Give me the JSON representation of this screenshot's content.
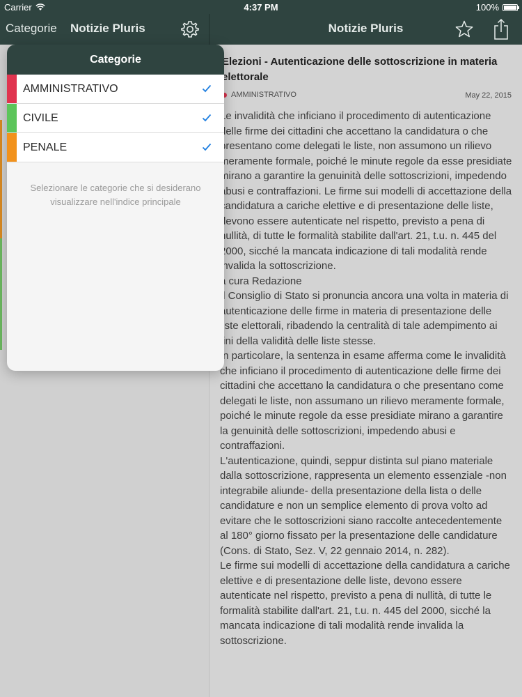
{
  "status_bar": {
    "carrier": "Carrier",
    "time": "4:37 PM",
    "battery": "100%"
  },
  "nav_left": {
    "categorie": "Categorie",
    "title": "Notizie Pluris"
  },
  "nav_right": {
    "title": "Notizie Pluris"
  },
  "popover": {
    "title": "Categorie",
    "categories": [
      {
        "label": "AMMINISTRATIVO",
        "color": "#e0344f",
        "checked": true
      },
      {
        "label": "CIVILE",
        "color": "#5cc55a",
        "checked": true
      },
      {
        "label": "PENALE",
        "color": "#f2921c",
        "checked": true
      }
    ],
    "note": "Selezionare le categorie che si desiderano visualizzare nell'indice principale"
  },
  "article": {
    "title": "Elezioni   - Autenticazione delle sottoscrizione in materia elettorale",
    "category": "AMMINISTRATIVO",
    "date": "May 22, 2015",
    "paragraphs": [
      "Le invalidità che inficiano il procedimento di autenticazione delle firme dei cittadini che accettano la candidatura o che presentano come delegati le liste, non assumono un rilievo meramente formale, poiché le minute regole da esse presidiate mirano a garantire la genuinità delle sottoscrizioni, impedendo abusi e contraffazioni. Le firme sui modelli di accettazione della candidatura a cariche elettive e di presentazione delle liste, devono essere autenticate nel rispetto, previsto a pena di nullità, di tutte le formalità stabilite dall'art. 21, t.u. n. 445 del 2000, sicché la mancata indicazione di tali modalità rende invalida la sottoscrizione.",
      "a cura Redazione",
      "Il Consiglio di Stato si pronuncia ancora una volta in materia di autenticazione delle firme in materia di presentazione delle liste elettorali, ribadendo la centralità di tale adempimento ai fini della validità delle liste stesse.",
      "In particolare, la sentenza in esame afferma come le invalidità che inficiano il procedimento di autenticazione delle firme dei cittadini che accettano la candidatura o che presentano come delegati le liste, non assumano un rilievo meramente formale, poiché le minute regole da esse presidiate mirano a garantire la genuinità delle sottoscrizioni, impedendo abusi e contraffazioni.",
      "L'autenticazione, quindi, seppur distinta sul piano materiale dalla sottoscrizione, rappresenta un elemento essenziale -non integrabile aliunde- della presentazione della lista o delle candidature e non un semplice elemento di prova volto ad evitare che le sottoscrizioni siano raccolte antecedentemente al 180° giorno fissato per la presentazione delle candidature (Cons. di Stato, Sez. V, 22 gennaio 2014, n. 282).",
      "Le firme sui modelli di accettazione della candidatura a cariche elettive e di presentazione delle liste, devono essere autenticate nel rispetto, previsto a pena di nullità, di tutte le formalità stabilite dall'art. 21, t.u. n. 445 del 2000, sicché la mancata indicazione di tali modalità rende invalida la sottoscrizione."
    ]
  },
  "colors": {
    "nav_bg": "#2f4440",
    "detail_bg": "#d3d3d3",
    "accent_check": "#1f7fe0"
  }
}
